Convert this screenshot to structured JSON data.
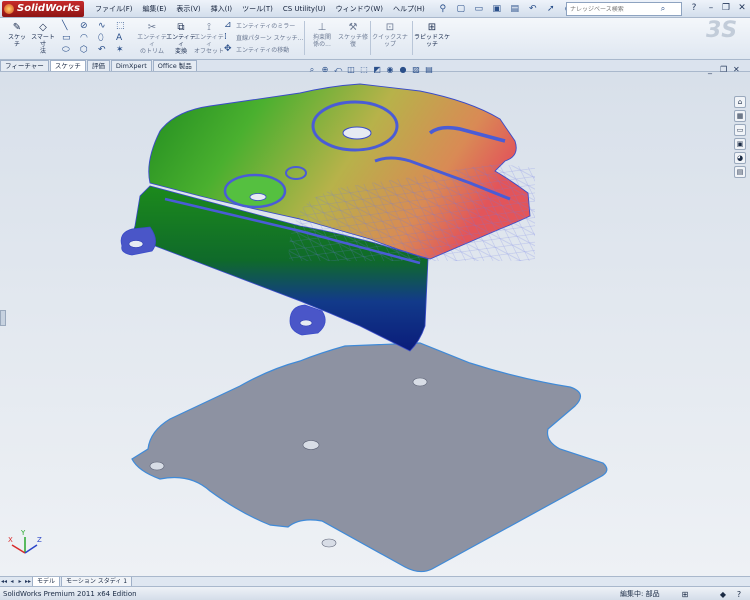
{
  "app": {
    "brand": "SolidWorks"
  },
  "menu": [
    "ファイル(F)",
    "編集(E)",
    "表示(V)",
    "挿入(I)",
    "ツール(T)",
    "CS Utility(U)",
    "ウィンドウ(W)",
    "ヘルプ(H)"
  ],
  "search": {
    "placeholder": "ナレッジベース検索"
  },
  "ribbon": {
    "sketch": "スケッチ",
    "smart_dim_1": "スマート寸",
    "smart_dim_2": "法",
    "trim_1": "エンティティ",
    "trim_2": "のトリム",
    "convert_1": "エンティティ",
    "convert_2": "変換",
    "offset_1": "エンティティ",
    "offset_2": "オフセット",
    "mirror": "エンティティのミラー",
    "linear_pattern": "直線パターン スケッチ...",
    "move": "エンティティの移動",
    "relations_1": "拘束関",
    "relations_2": "係の...",
    "repair_1": "スケッチ修",
    "repair_2": "復",
    "quick_snap": "クイックスナップ",
    "rapid_sketch": "ラピッドスケッチ"
  },
  "tabs": [
    "フィーチャー",
    "スケッチ",
    "評価",
    "DimXpert",
    "Office 製品"
  ],
  "active_tab": "スケッチ",
  "bottom_tabs": [
    "モデル",
    "モーション スタディ 1"
  ],
  "status": {
    "left": "SolidWorks Premium 2011 x64 Edition",
    "right": "編集中: 部品"
  },
  "triad": {
    "x": "X",
    "y": "Y",
    "z": "Z"
  },
  "colors": {
    "model_edge": "#4a5cd6",
    "flat_fill": "#8d92a2",
    "accent": "#2a4f8a"
  }
}
